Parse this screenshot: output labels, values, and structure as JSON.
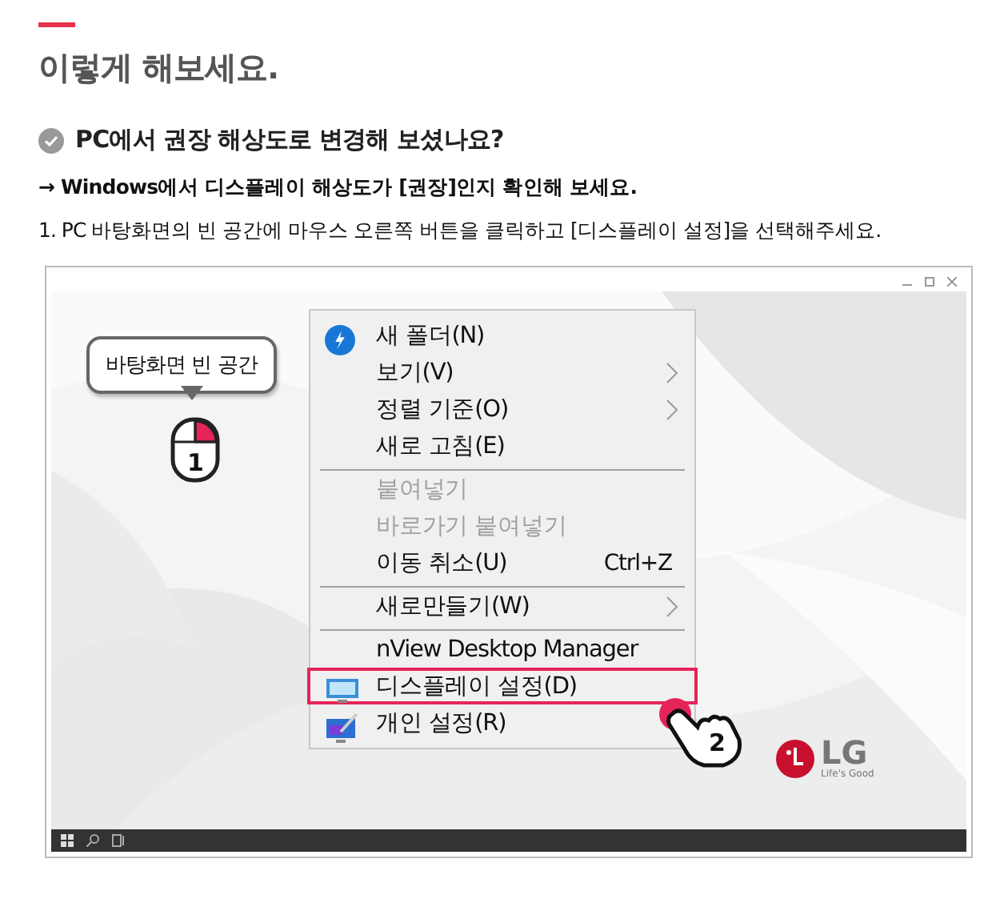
{
  "heading": "이렇게 해보세요.",
  "question": "PC에서 권장 해상도로 변경해 보셨나요?",
  "hint": "→ Windows에서 디스플레이 해상도가 [권장]인지 확인해 보세요.",
  "step": "1. PC 바탕화면의 빈 공간에 마우스 오른쪽 버튼을 클릭하고 [디스플레이 설정]을 선택해주세요.",
  "screenshot": {
    "callout": "바탕화면 빈 공간",
    "mouse_step": "1",
    "pointer_step": "2",
    "logo": {
      "brand": "LG",
      "slogan": "Life's Good"
    },
    "menu": [
      {
        "label": "새 폴더(N)",
        "kind": "bolt",
        "submenu": false,
        "disabled": false,
        "selected": false,
        "separator_before": false
      },
      {
        "label": "보기(V)",
        "submenu": true,
        "disabled": false,
        "selected": false,
        "separator_before": false
      },
      {
        "label": "정렬 기준(O)",
        "submenu": true,
        "disabled": false,
        "selected": false,
        "separator_before": false
      },
      {
        "label": "새로 고침(E)",
        "submenu": false,
        "disabled": false,
        "selected": false,
        "separator_before": false
      },
      {
        "label": "붙여넣기",
        "submenu": false,
        "disabled": true,
        "selected": false,
        "separator_before": true
      },
      {
        "label": "바로가기 붙여넣기",
        "submenu": false,
        "disabled": true,
        "selected": false,
        "separator_before": false
      },
      {
        "label": "이동 취소(U)",
        "shortcut": "Ctrl+Z",
        "submenu": false,
        "disabled": false,
        "selected": false,
        "separator_before": false
      },
      {
        "label": "새로만들기(W)",
        "submenu": true,
        "disabled": false,
        "selected": false,
        "separator_before": true
      },
      {
        "label": "nView Desktop Manager",
        "submenu": false,
        "disabled": false,
        "selected": false,
        "separator_before": true
      },
      {
        "label": "디스플레이 설정(D)",
        "kind": "monitor",
        "submenu": false,
        "disabled": false,
        "selected": true,
        "separator_before": false
      },
      {
        "label": "개인 설정(R)",
        "kind": "personalize",
        "submenu": false,
        "disabled": false,
        "selected": false,
        "separator_before": false
      }
    ]
  }
}
